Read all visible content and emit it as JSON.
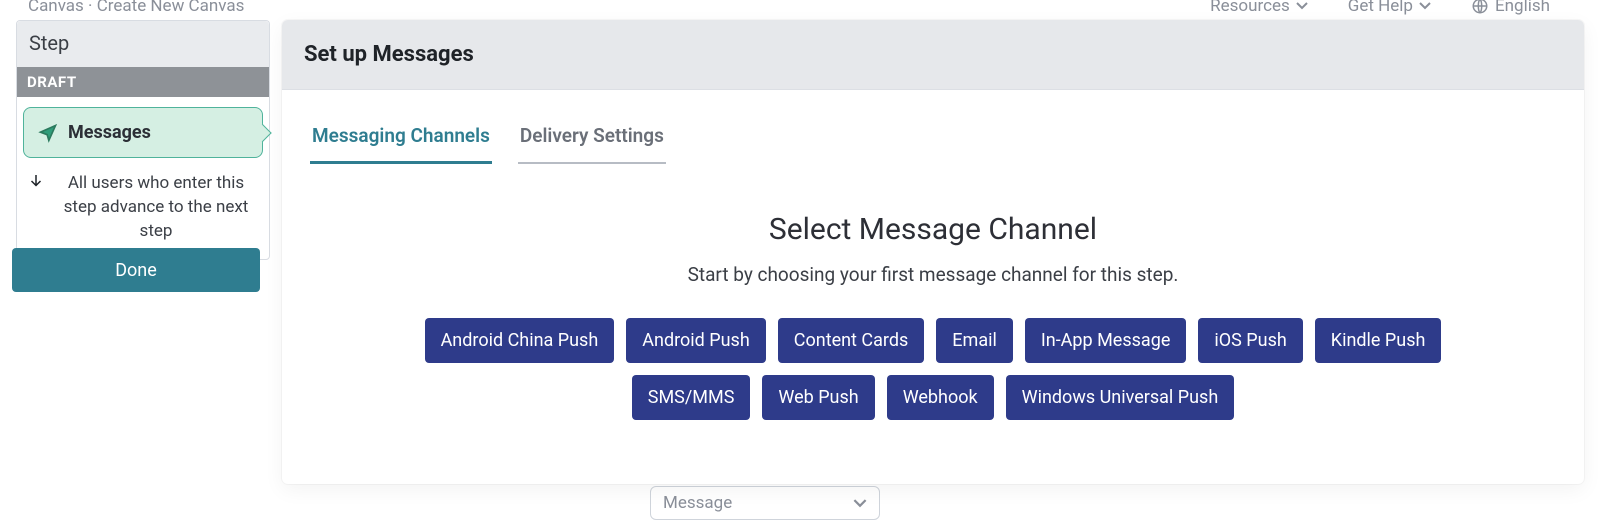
{
  "background": {
    "breadcrumb": "Canvas · Create New Canvas",
    "resources": "Resources",
    "get_help": "Get Help",
    "language": "English",
    "left_faint": "",
    "dropdown_label": "Message"
  },
  "sidebar": {
    "header": "Step",
    "badge": "DRAFT",
    "item_label": "Messages",
    "info_text": "All users who enter this step advance to the next step",
    "done_label": "Done"
  },
  "panel": {
    "title": "Set up Messages",
    "tabs": [
      {
        "label": "Messaging Channels",
        "active": true
      },
      {
        "label": "Delivery Settings",
        "active": false
      }
    ],
    "heading": "Select Message Channel",
    "subheading": "Start by choosing your first message channel for this step.",
    "channels": [
      "Android China Push",
      "Android Push",
      "Content Cards",
      "Email",
      "In-App Message",
      "iOS Push",
      "Kindle Push",
      "SMS/MMS",
      "Web Push",
      "Webhook",
      "Windows Universal Push"
    ]
  }
}
